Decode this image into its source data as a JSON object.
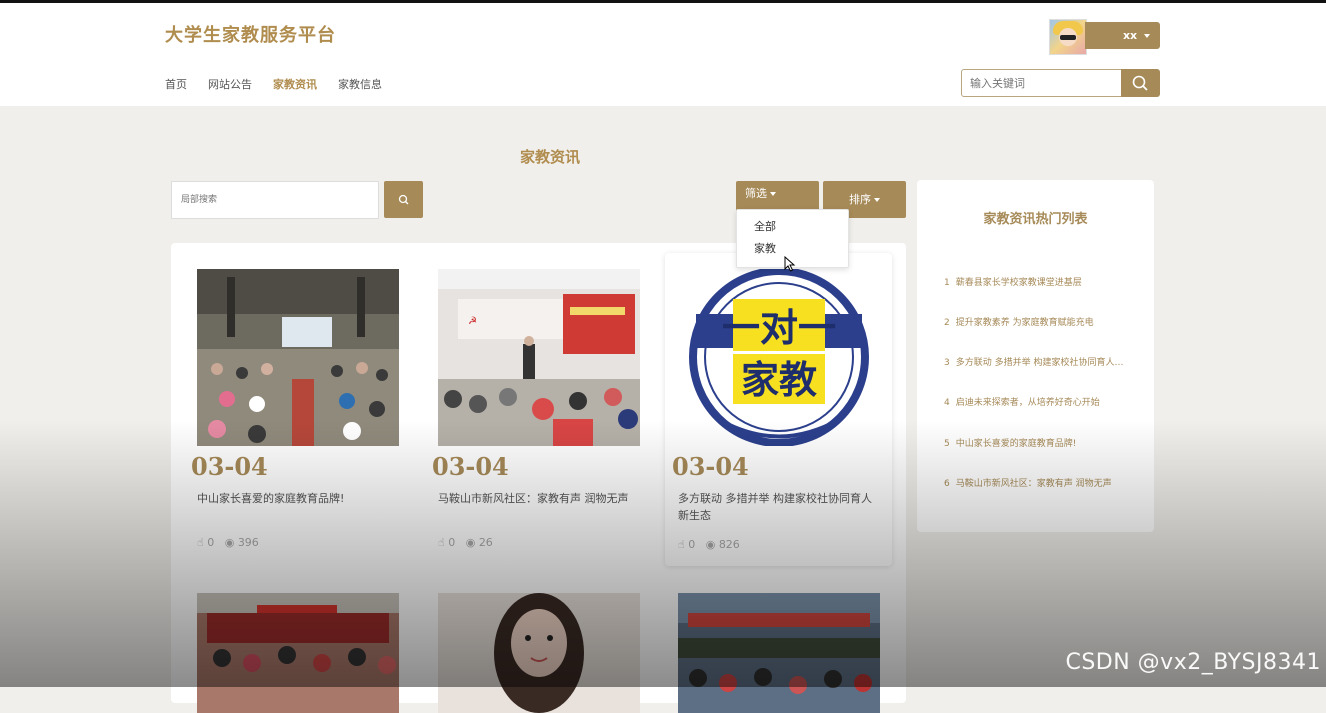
{
  "site_title": "大学生家教服务平台",
  "nav": [
    "首页",
    "网站公告",
    "家教资讯",
    "家教信息"
  ],
  "nav_active": "家教资讯",
  "user": {
    "name": "xx"
  },
  "top_search": {
    "placeholder": "输入关键词"
  },
  "page_heading": "家教资讯",
  "local_search": {
    "placeholder": "局部搜索"
  },
  "filter": {
    "label": "筛选",
    "options": [
      "全部",
      "家教"
    ]
  },
  "sort": {
    "label": "排序"
  },
  "cards": [
    {
      "date": "03-04",
      "title": "中山家长喜爱的家庭教育品牌!",
      "likes": "0",
      "views": "396"
    },
    {
      "date": "03-04",
      "title": "马鞍山市新风社区：家教有声 润物无声",
      "likes": "0",
      "views": "26"
    },
    {
      "date": "03-04",
      "title": "多方联动 多措并举 构建家校社协同育人新生态",
      "likes": "0",
      "views": "826",
      "image_text": [
        "一对一",
        "家教"
      ]
    }
  ],
  "hot_list": {
    "title": "家教资讯热门列表",
    "items": [
      {
        "num": "1",
        "text": "蕲春县家长学校家教课堂进基层"
      },
      {
        "num": "2",
        "text": "提升家教素养 为家庭教育赋能充电"
      },
      {
        "num": "3",
        "text": "多方联动 多措并举 构建家校社协同育人新生态"
      },
      {
        "num": "4",
        "text": "启迪未来探索者，从培养好奇心开始"
      },
      {
        "num": "5",
        "text": "中山家长喜爱的家庭教育品牌!"
      },
      {
        "num": "6",
        "text": "马鞍山市新风社区：家教有声 润物无声"
      }
    ]
  },
  "watermark": "CSDN @vx2_BYSJ8341",
  "colors": {
    "accent": "#a68a58",
    "title": "#b08d4f",
    "background": "#f1efeb"
  }
}
